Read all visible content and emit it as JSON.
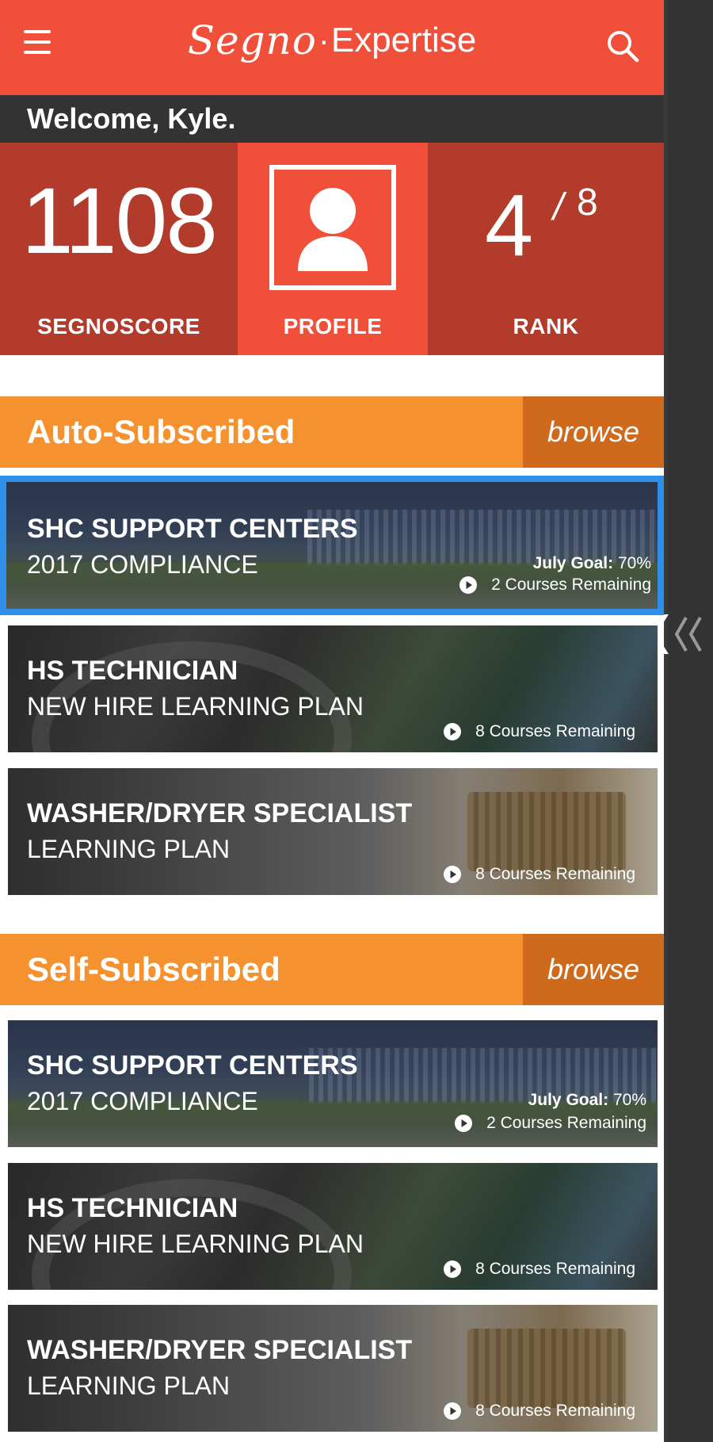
{
  "header": {
    "logo_segno": "Segno",
    "logo_dot": "·",
    "logo_expertise": "Expertise"
  },
  "welcome": "Welcome, Kyle.",
  "stats": {
    "score_value": "1108",
    "score_label": "SEGNOSCORE",
    "profile_label": "PROFILE",
    "rank_value": "4",
    "rank_separator": "/",
    "rank_total": "8",
    "rank_label": "RANK"
  },
  "sections": [
    {
      "title": "Auto-Subscribed",
      "browse_label": "browse",
      "cards": [
        {
          "title": "SHC SUPPORT CENTERS",
          "subtitle": "2017 COMPLIANCE",
          "goal_label": "July Goal:",
          "goal_value": "70%",
          "remaining": "2 Courses Remaining",
          "selected": true
        },
        {
          "title": "HS TECHNICIAN",
          "subtitle": "NEW HIRE LEARNING PLAN",
          "remaining": "8 Courses Remaining"
        },
        {
          "title": "WASHER/DRYER SPECIALIST",
          "subtitle": "LEARNING PLAN",
          "remaining": "8 Courses Remaining"
        }
      ]
    },
    {
      "title": "Self-Subscribed",
      "browse_label": "browse",
      "cards": [
        {
          "title": "SHC SUPPORT CENTERS",
          "subtitle": "2017 COMPLIANCE",
          "goal_label": "July Goal:",
          "goal_value": "70%",
          "remaining": "2 Courses Remaining"
        },
        {
          "title": "HS TECHNICIAN",
          "subtitle": "NEW HIRE LEARNING PLAN",
          "remaining": "8 Courses Remaining"
        },
        {
          "title": "WASHER/DRYER SPECIALIST",
          "subtitle": "LEARNING PLAN",
          "remaining": "8 Courses Remaining"
        }
      ]
    }
  ],
  "colors": {
    "header": "#f0503a",
    "stat_dark": "#b23b2c",
    "section_orange": "#f5922f",
    "browse_orange": "#cf6a1c",
    "selection_blue": "#2f8fe8",
    "welcome_bar": "#333333"
  },
  "icons": [
    "menu-icon",
    "search-icon",
    "profile-avatar-icon",
    "play-icon",
    "drawer-chevron-icon"
  ]
}
